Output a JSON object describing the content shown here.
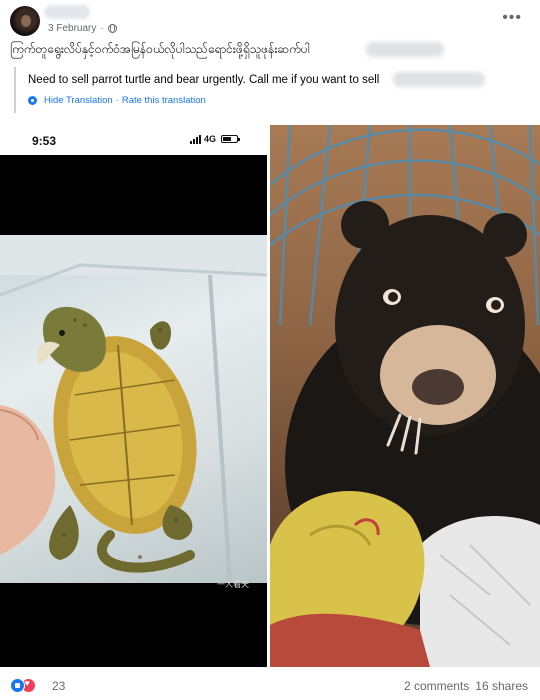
{
  "post": {
    "author_name": "",
    "date": "3 February",
    "audience_icon": "globe-icon",
    "more_icon": "more-horizontal-icon",
    "original_text": "ကြက်တူရွေးလိပ်နှင့်ဝက်ဝံအမြန်ဝယ်လိုပါသည်ရောင်းဖို့ရှိသူဖုန်းဆက်ပါ",
    "translation_text": "Need to sell parrot turtle and bear urgently. Call me if you want to sell",
    "hide_translation_label": "Hide Translation",
    "separator": "·",
    "rate_translation_label": "Rate this translation"
  },
  "photos": {
    "left": {
      "status_time": "9:53",
      "status_network": "4G",
      "watermark": "一人看天"
    }
  },
  "footer": {
    "reaction_count": "23",
    "comments_label": "2 comments",
    "shares_label": "16 shares"
  },
  "colors": {
    "link": "#1877f2",
    "secondary_text": "#65676b",
    "like": "#1877f2",
    "love": "#f33e58"
  }
}
